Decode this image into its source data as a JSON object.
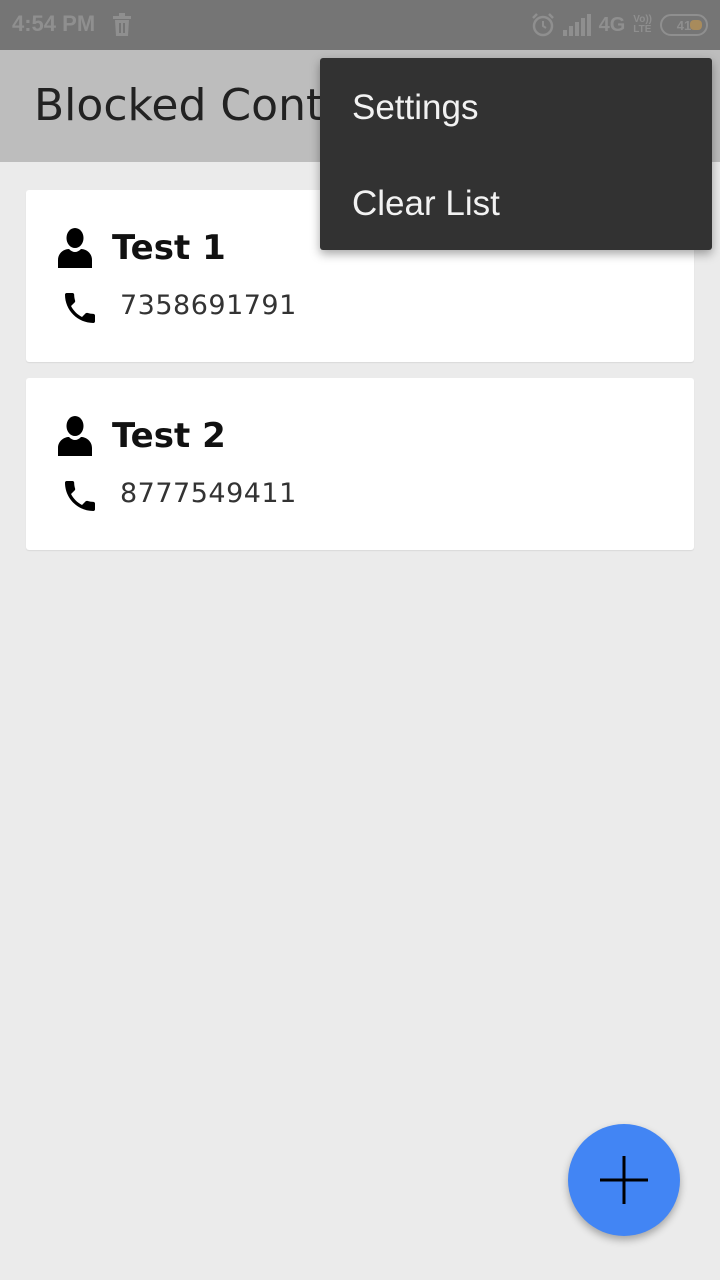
{
  "status_bar": {
    "time": "4:54 PM",
    "network": "4G",
    "volte_top": "Vo))",
    "volte_bottom": "LTE",
    "battery": "41",
    "icons": [
      "trash-icon",
      "alarm-icon",
      "signal-icon",
      "battery-icon"
    ]
  },
  "app_bar": {
    "title": "Blocked Contacts"
  },
  "contacts": [
    {
      "name": "Test 1",
      "number": "7358691791"
    },
    {
      "name": "Test 2",
      "number": "8777549411"
    }
  ],
  "menu": {
    "items": [
      {
        "label": "Settings"
      },
      {
        "label": "Clear List"
      }
    ]
  },
  "fab": {
    "icon": "plus-icon",
    "color": "#4285f4"
  },
  "colors": {
    "status_bar": "#757575",
    "app_bar": "#bdbdbd",
    "background": "#ebebeb",
    "menu": "#323232",
    "accent": "#4285f4"
  }
}
